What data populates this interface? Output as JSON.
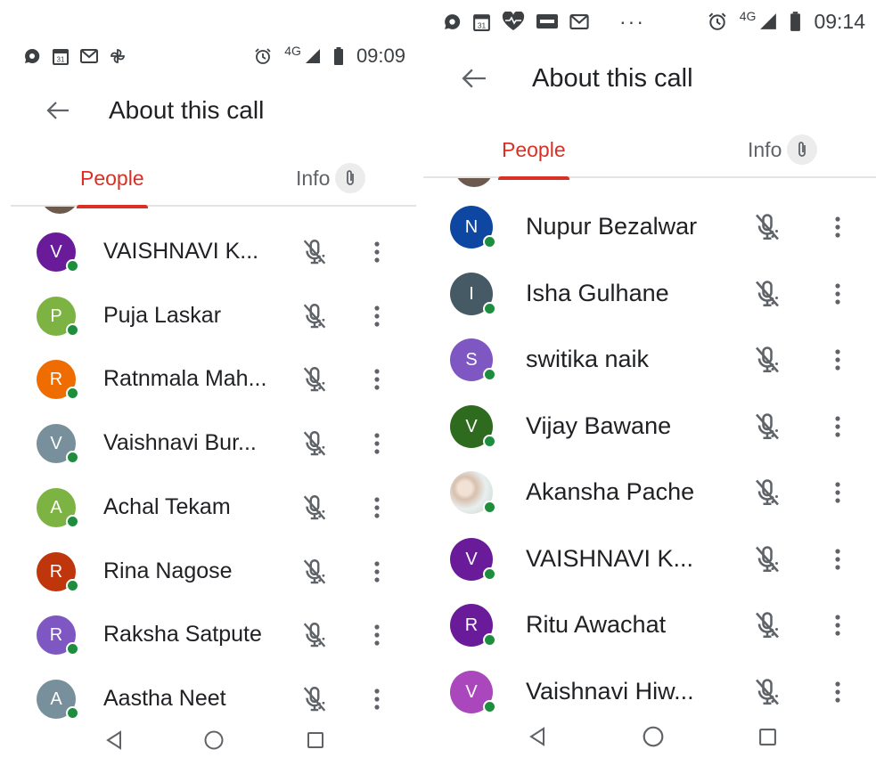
{
  "left": {
    "status_bar": {
      "time": "09:09",
      "network": "4G",
      "icons": [
        "chat-icon",
        "calendar-icon",
        "gmail-icon",
        "pinwheel-icon",
        "alarm-icon",
        "signal-icon",
        "battery-icon"
      ],
      "calendar_day": "31"
    },
    "title": "About this call",
    "tabs": {
      "people": "People",
      "info": "Info"
    },
    "participants": [
      {
        "initial": "V",
        "name": "VAISHNAVI K...",
        "color": "#6a1b9a"
      },
      {
        "initial": "P",
        "name": "Puja Laskar",
        "color": "#7cb342"
      },
      {
        "initial": "R",
        "name": "Ratnmala Mah...",
        "color": "#ef6c00"
      },
      {
        "initial": "V",
        "name": "Vaishnavi Bur...",
        "color": "#78909c"
      },
      {
        "initial": "A",
        "name": "Achal Tekam",
        "color": "#7cb342"
      },
      {
        "initial": "R",
        "name": "Rina Nagose",
        "color": "#bf360c"
      },
      {
        "initial": "R",
        "name": "Raksha Satpute",
        "color": "#7e57c2"
      },
      {
        "initial": "A",
        "name": "Aastha Neet",
        "color": "#78909c"
      }
    ]
  },
  "right": {
    "status_bar": {
      "time": "09:14",
      "network": "4G",
      "overflow": "···",
      "icons": [
        "chat-icon",
        "calendar-icon",
        "health-icon",
        "app-icon",
        "gmail-icon",
        "alarm-icon",
        "signal-icon",
        "battery-icon"
      ],
      "calendar_day": "31"
    },
    "title": "About this call",
    "tabs": {
      "people": "People",
      "info": "Info"
    },
    "participants": [
      {
        "initial": "N",
        "name": "Nupur Bezalwar",
        "color": "#0d47a1"
      },
      {
        "initial": "I",
        "name": "Isha Gulhane",
        "color": "#455a64"
      },
      {
        "initial": "S",
        "name": "switika naik",
        "color": "#7e57c2"
      },
      {
        "initial": "V",
        "name": "Vijay Bawane",
        "color": "#2e6b1f"
      },
      {
        "initial": "",
        "name": "Akansha Pache",
        "color": "#e0d0c4",
        "photo": true
      },
      {
        "initial": "V",
        "name": "VAISHNAVI K...",
        "color": "#6a1b9a"
      },
      {
        "initial": "R",
        "name": "Ritu Awachat",
        "color": "#6a1b9a"
      },
      {
        "initial": "V",
        "name": "Vaishnavi Hiw...",
        "color": "#ab47bc"
      }
    ]
  },
  "colors": {
    "accent": "#d93025",
    "online": "#1e8e3e",
    "icon_gray": "#5f6368"
  }
}
